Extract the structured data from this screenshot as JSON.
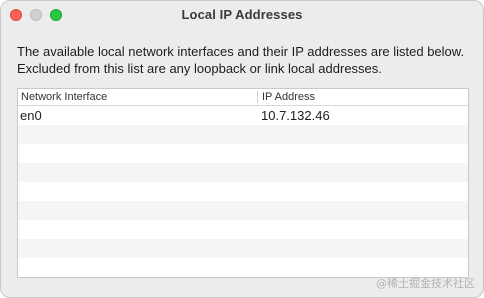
{
  "window": {
    "title": "Local IP Addresses"
  },
  "description": "The available local network interfaces and their IP addresses are listed below.  Excluded from this list are any loopback or link local addresses.",
  "table": {
    "columns": [
      "Network Interface",
      "IP Address"
    ],
    "rows": [
      [
        "en0",
        "10.7.132.46"
      ]
    ]
  },
  "watermark": "@稀土掘金技术社区"
}
